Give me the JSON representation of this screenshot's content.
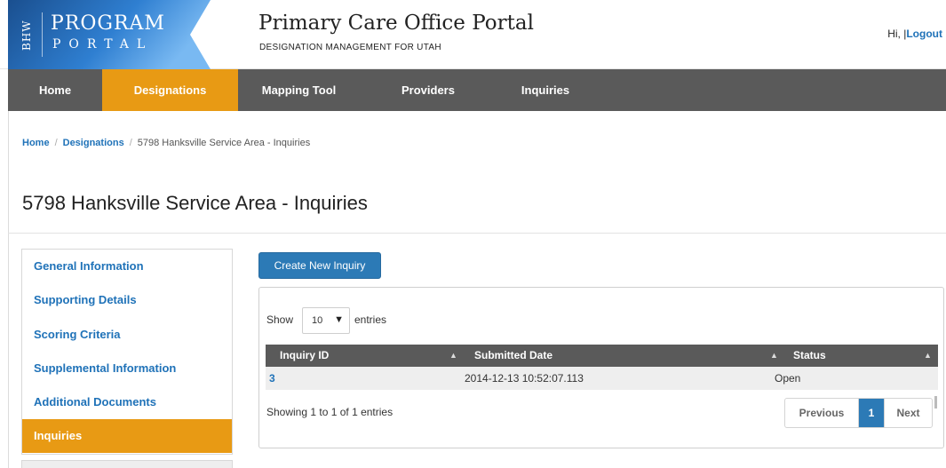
{
  "header": {
    "logo": {
      "bhw": "BHW",
      "program": "PROGRAM",
      "portal": "PORTAL"
    },
    "title": "Primary Care Office Portal",
    "subtitle": "DESIGNATION MANAGEMENT FOR UTAH",
    "greeting": "Hi, |",
    "logout": "Logout"
  },
  "nav": {
    "items": [
      {
        "label": "Home"
      },
      {
        "label": "Designations",
        "active": true
      },
      {
        "label": "Mapping Tool"
      },
      {
        "label": "Providers"
      },
      {
        "label": "Inquiries"
      }
    ]
  },
  "breadcrumb": {
    "home": "Home",
    "designations": "Designations",
    "current": "5798 Hanksville Service Area - Inquiries",
    "separator": "/"
  },
  "page_title": "5798 Hanksville Service Area - Inquiries",
  "sidebar": {
    "items": [
      {
        "label": "General Information"
      },
      {
        "label": "Supporting Details"
      },
      {
        "label": "Scoring Criteria"
      },
      {
        "label": "Supplemental Information"
      },
      {
        "label": "Additional Documents"
      },
      {
        "label": "Inquiries",
        "active": true
      }
    ]
  },
  "main": {
    "create_button": "Create New Inquiry",
    "show_label": "Show",
    "page_size": "10",
    "entries_label": "entries",
    "columns": [
      "Inquiry ID",
      "Submitted Date",
      "Status"
    ],
    "rows": [
      {
        "id": "3",
        "submitted": "2014-12-13 10:52:07.113",
        "status": "Open"
      }
    ],
    "info": "Showing 1 to 1 of 1 entries",
    "pager": {
      "previous": "Previous",
      "current": "1",
      "next": "Next"
    }
  },
  "colors": {
    "accent": "#e89a14",
    "nav_bg": "#5a5a5a",
    "primary": "#2c7ab6",
    "link": "#1f72b8"
  },
  "icons": [
    "sort-asc-icon",
    "sort-icon",
    "dropdown-arrow-icon"
  ]
}
